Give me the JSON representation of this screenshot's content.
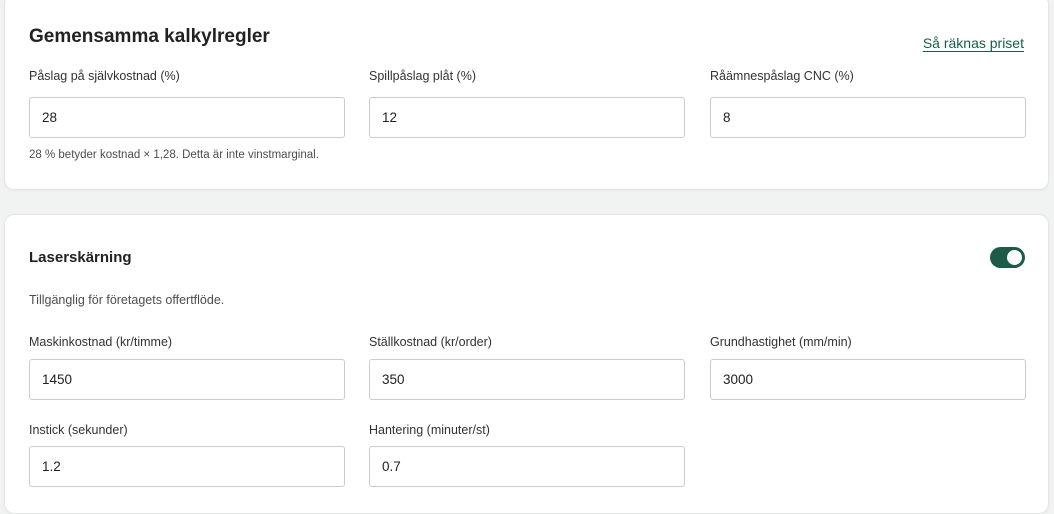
{
  "common": {
    "title": "Gemensamma kalkylregler",
    "help_link": "Så räknas priset",
    "fields": [
      {
        "label": "Påslag på självkostnad (%)",
        "value": "28"
      },
      {
        "label": "Spillpåslag plåt (%)",
        "value": "12"
      },
      {
        "label": "Råämnespåslag CNC (%)",
        "value": "8"
      }
    ],
    "hint": "28 % betyder kostnad × 1,28. Detta är inte vinstmarginal."
  },
  "laser": {
    "title": "Laserskärning",
    "enabled": true,
    "subtitle": "Tillgänglig för företagets offertflöde.",
    "fields": [
      {
        "label": "Maskinkostnad (kr/timme)",
        "value": "1450"
      },
      {
        "label": "Ställkostnad (kr/order)",
        "value": "350"
      },
      {
        "label": "Grundhastighet (mm/min)",
        "value": "3000"
      },
      {
        "label": "Instick (sekunder)",
        "value": "1.2"
      },
      {
        "label": "Hantering (minuter/st)",
        "value": "0.7"
      }
    ]
  },
  "colors": {
    "accent": "#1d5a48",
    "link": "#1a5c48"
  }
}
